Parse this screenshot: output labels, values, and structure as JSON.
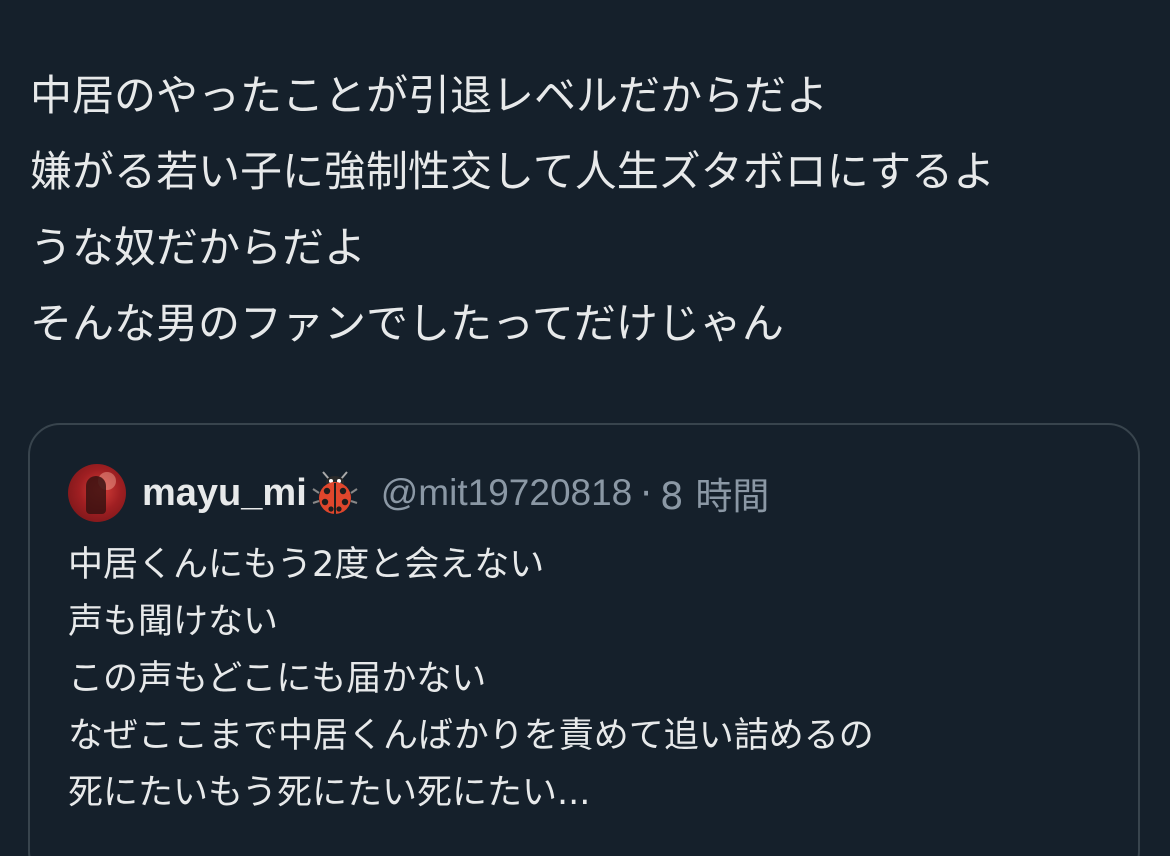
{
  "tweet": {
    "text_lines": [
      "中居のやったことが引退レベルだからだよ",
      "嫌がる若い子に強制性交して人生ズタボロにするよ",
      "うな奴だからだよ",
      "そんな男のファンでしたってだけじゃん"
    ]
  },
  "quote": {
    "display_name": "mayu_mi",
    "handle": "@mit19720818",
    "separator": "·",
    "timestamp": "8 時間",
    "icons": {
      "avatar": "user-avatar",
      "emoji": "ladybug-icon"
    },
    "text_lines": [
      "中居くんにもう2度と会えない",
      "声も聞けない",
      "この声もどこにも届かない",
      "なぜここまで中居くんばかりを責めて追い詰めるの",
      "死にたいもう死にたい死にたい..."
    ]
  },
  "colors": {
    "background": "#15202b",
    "text_primary": "#e7e9ea",
    "text_secondary": "#8b98a5",
    "border": "#38444d"
  }
}
